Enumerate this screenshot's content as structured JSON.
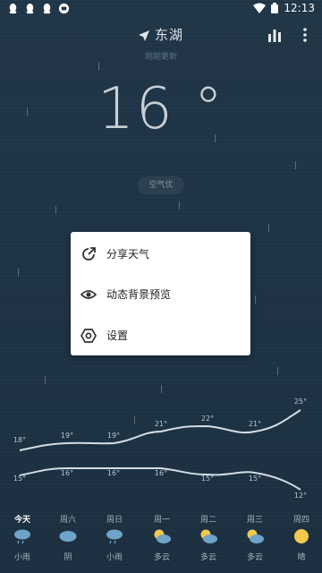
{
  "status_bar": {
    "time": "12:13"
  },
  "header": {
    "location": "东湖",
    "updated": "刚刚更新"
  },
  "current": {
    "temperature": "16 °",
    "air_quality": "空气优"
  },
  "menu": {
    "items": [
      {
        "label": "分享天气",
        "icon": "share-icon"
      },
      {
        "label": "动态背景预览",
        "icon": "eye-icon"
      },
      {
        "label": "设置",
        "icon": "settings-icon"
      }
    ]
  },
  "forecast": {
    "highs": [
      "18°",
      "19°",
      "19°",
      "21°",
      "22°",
      "21°",
      "25°"
    ],
    "lows": [
      "15°",
      "16°",
      "16°",
      "16°",
      "15°",
      "15°",
      "12°"
    ],
    "days": [
      "今天",
      "周六",
      "周日",
      "周一",
      "周二",
      "周三",
      "周四"
    ],
    "conditions": [
      "小雨",
      "阴",
      "小雨",
      "多云",
      "多云",
      "多云",
      "晴"
    ],
    "icons": [
      "light-rain-icon",
      "overcast-icon",
      "light-rain-icon",
      "partly-cloudy-icon",
      "partly-cloudy-icon",
      "partly-cloudy-icon",
      "sunny-icon"
    ]
  },
  "colors": {
    "background": "#1e3345",
    "sun": "#f2c94c",
    "cloud": "#6fa3c7"
  }
}
